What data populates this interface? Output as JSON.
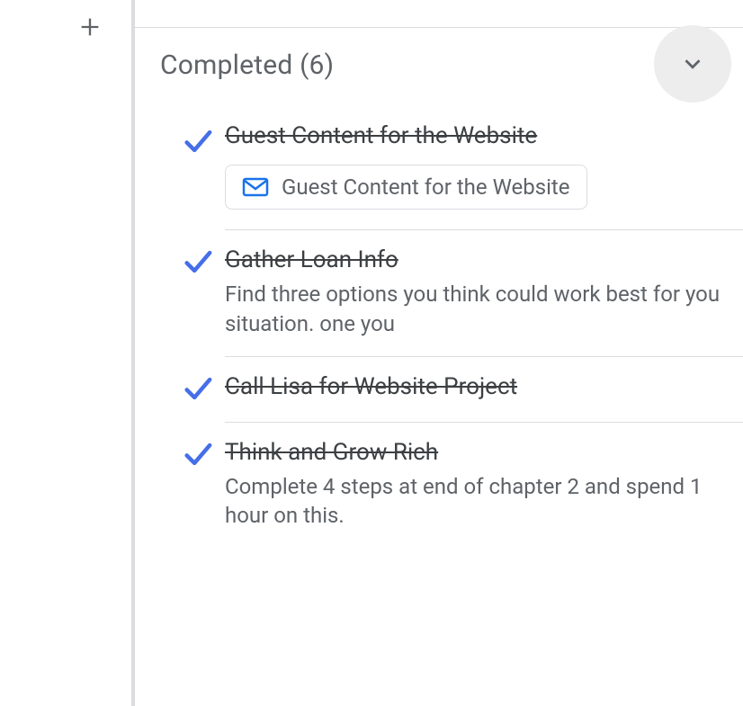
{
  "section": {
    "title": "Completed (6)"
  },
  "tasks": [
    {
      "title": "Guest Content for the Website",
      "attachment_label": "Guest Content for the Website"
    },
    {
      "title": "Gather Loan Info",
      "description": "Find three options you think could work best for you situation. one you"
    },
    {
      "title": "Call Lisa for Website Project"
    },
    {
      "title": "Think and Grow Rich",
      "description": "Complete 4 steps at end of chapter 2 and spend 1 hour on this."
    }
  ]
}
